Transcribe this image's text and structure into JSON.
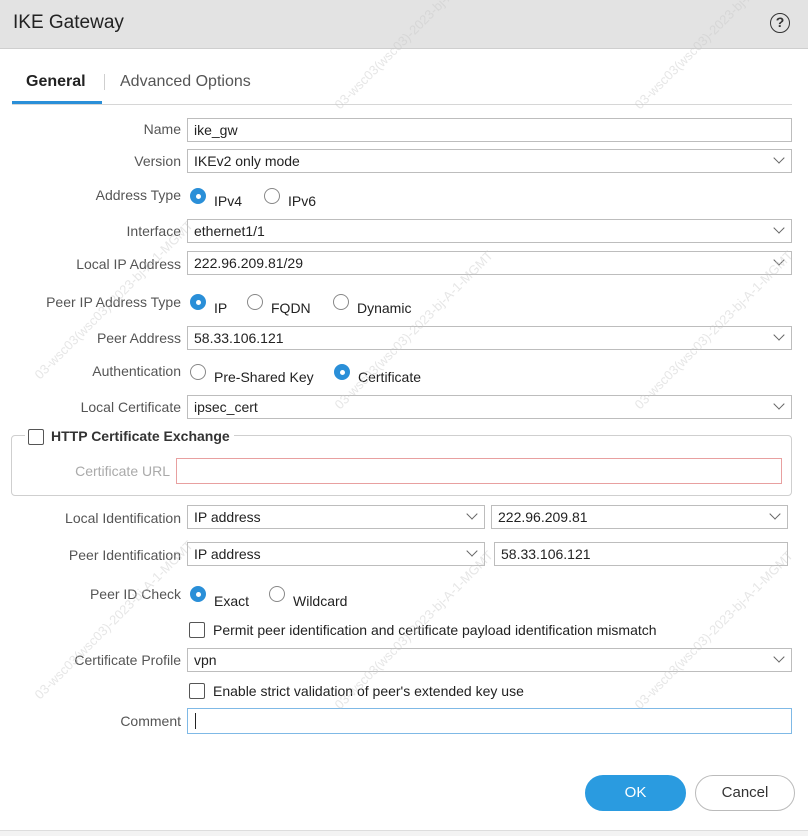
{
  "dialog": {
    "title": "IKE Gateway",
    "help_icon": "?"
  },
  "tabs": [
    {
      "label": "General",
      "active": true
    },
    {
      "label": "Advanced Options",
      "active": false
    }
  ],
  "form": {
    "name": {
      "label": "Name",
      "value": "ike_gw"
    },
    "version": {
      "label": "Version",
      "value": "IKEv2 only mode"
    },
    "address_type": {
      "label": "Address Type",
      "options": [
        "IPv4",
        "IPv6"
      ],
      "selected": "IPv4"
    },
    "interface": {
      "label": "Interface",
      "value": "ethernet1/1"
    },
    "local_ip": {
      "label": "Local IP Address",
      "value": "222.96.209.81/29"
    },
    "peer_ip_type": {
      "label": "Peer IP Address Type",
      "options": [
        "IP",
        "FQDN",
        "Dynamic"
      ],
      "selected": "IP"
    },
    "peer_address": {
      "label": "Peer Address",
      "value": "58.33.106.121"
    },
    "authentication": {
      "label": "Authentication",
      "options": [
        "Pre-Shared Key",
        "Certificate"
      ],
      "selected": "Certificate"
    },
    "local_certificate": {
      "label": "Local Certificate",
      "value": "ipsec_cert"
    },
    "http_cert_exchange": {
      "label": "HTTP Certificate Exchange",
      "checked": false,
      "url_label": "Certificate URL",
      "url_value": ""
    },
    "local_identification": {
      "label": "Local Identification",
      "type": "IP address",
      "value": "222.96.209.81"
    },
    "peer_identification": {
      "label": "Peer Identification",
      "type": "IP address",
      "value": "58.33.106.121"
    },
    "peer_id_check": {
      "label": "Peer ID Check",
      "options": [
        "Exact",
        "Wildcard"
      ],
      "selected": "Exact"
    },
    "permit_mismatch": {
      "label": "Permit peer identification and certificate payload identification mismatch",
      "checked": false
    },
    "certificate_profile": {
      "label": "Certificate Profile",
      "value": "vpn"
    },
    "strict_validation": {
      "label": "Enable strict validation of peer's extended key use",
      "checked": false
    },
    "comment": {
      "label": "Comment",
      "value": ""
    }
  },
  "buttons": {
    "ok": "OK",
    "cancel": "Cancel"
  },
  "watermark": {
    "text": "03-wsc03(wsc03)-2023-bj-A-1-MGMT"
  },
  "colors": {
    "accent": "#2a8fd8",
    "titlebar": "#e3e3e3",
    "error_border": "#e8a0a0"
  }
}
